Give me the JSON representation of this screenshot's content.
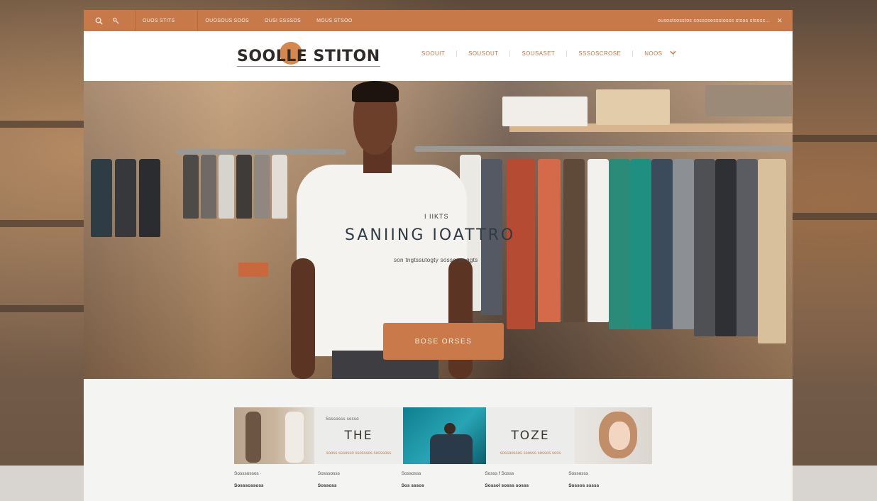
{
  "colors": {
    "accent": "#c7794a",
    "accent_dark": "#b86a3c",
    "header_bg": "#ffffff",
    "page_bg": "#f3f2f0",
    "text_dark": "#2e2b29"
  },
  "topbar": {
    "search_icon": "search-icon",
    "tools_icon": "wrench-icon",
    "links": [
      "ouos stits",
      "ouosous soos",
      "ousi ssssos",
      "mous stsoo"
    ],
    "right_text": "ousostsosstos sossosessstosss stsos stsoss...",
    "close_icon": "close-icon"
  },
  "header": {
    "logo_text": "SOOLLE STITON",
    "nav": [
      "SOOUIT",
      "SOUSOUT",
      "SOUSASET",
      "SSSOSCROSE",
      "NOOS"
    ],
    "chevron": "chevron-down-icon"
  },
  "hero": {
    "kicker": "I IIKTS",
    "title": "SANIING  IOATTRO",
    "subtitle": "son tngtssutogty sosso sa ggts",
    "button_label": "BOSE ORSES"
  },
  "cards": [
    {
      "type": "image",
      "name": "men-fashion-image"
    },
    {
      "type": "text",
      "kicker": "Ssssosss sosso",
      "title": "THE",
      "caption": "sooss sssosso ssosssos sosssoss"
    },
    {
      "type": "image",
      "name": "teal-shirt-image"
    },
    {
      "type": "text",
      "kicker": "",
      "title": "TOZE",
      "caption": "sossoossos ssosss sossos soss"
    },
    {
      "type": "image",
      "name": "woman-portrait-image"
    }
  ],
  "products": [
    {
      "category": "Sosssossos ·",
      "name": "Sosssossoss"
    },
    {
      "category": "Sosssosss",
      "name": "Sossoss"
    },
    {
      "category": "Sossosss",
      "name": "Sos sssos"
    },
    {
      "category": "Sosss  f Sosss",
      "name": "Sossol sosss sosss"
    },
    {
      "category": "Sossosss",
      "name": "Sossos sssss"
    }
  ]
}
